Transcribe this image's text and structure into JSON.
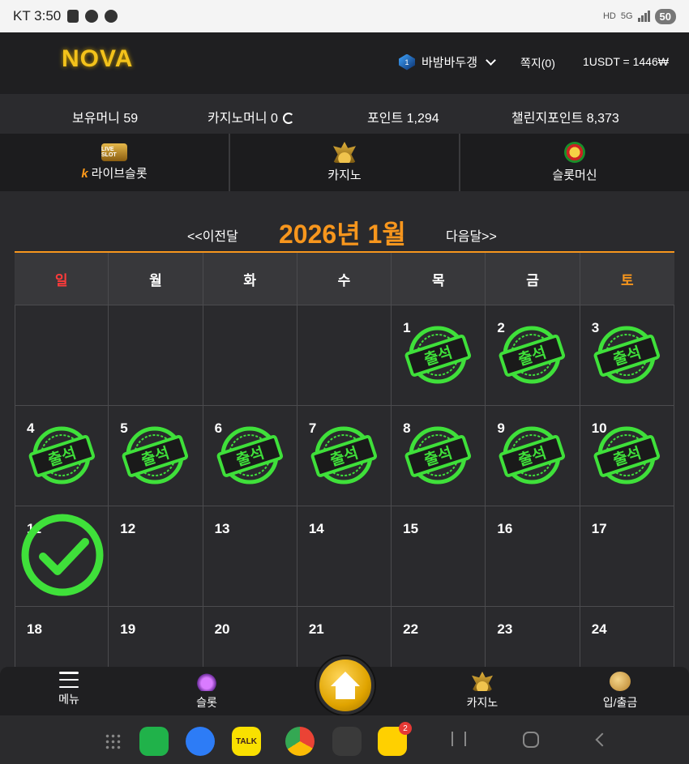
{
  "status_bar": {
    "carrier_time": "KT 3:50",
    "network": "5G",
    "hd": "HD",
    "battery": "50"
  },
  "header": {
    "logo": "NOVA",
    "user": {
      "rank": "1",
      "name": "바밤바두갱"
    },
    "messages_label": "쪽지(0)",
    "exchange_rate": "1USDT = 1446₩"
  },
  "balance": {
    "holding_money": "보유머니 59",
    "casino_money": "카지노머니 0",
    "points": "포인트 1,294",
    "challenge_points": "챌린지포인트 8,373"
  },
  "game_tabs": [
    {
      "label": "라이브슬롯",
      "icon": "live-slot-icon",
      "icon_text": "LIVE SLOT"
    },
    {
      "label": "카지노",
      "icon": "casino-crown-icon"
    },
    {
      "label": "슬롯머신",
      "icon": "slot-machine-icon"
    }
  ],
  "calendar": {
    "prev": "<<이전달",
    "title": "2026년 1월",
    "next": "다음달>>",
    "weekdays": [
      "일",
      "월",
      "화",
      "수",
      "목",
      "금",
      "토"
    ],
    "stamp_text": "출석",
    "weeks": [
      [
        {
          "day": "",
          "attended": false
        },
        {
          "day": "",
          "attended": false
        },
        {
          "day": "",
          "attended": false
        },
        {
          "day": "",
          "attended": false
        },
        {
          "day": "1",
          "attended": true
        },
        {
          "day": "2",
          "attended": true
        },
        {
          "day": "3",
          "attended": true
        }
      ],
      [
        {
          "day": "4",
          "attended": true
        },
        {
          "day": "5",
          "attended": true
        },
        {
          "day": "6",
          "attended": true
        },
        {
          "day": "7",
          "attended": true
        },
        {
          "day": "8",
          "attended": true
        },
        {
          "day": "9",
          "attended": true
        },
        {
          "day": "10",
          "attended": true
        }
      ],
      [
        {
          "day": "11",
          "attended": false,
          "today": true
        },
        {
          "day": "12",
          "attended": false
        },
        {
          "day": "13",
          "attended": false
        },
        {
          "day": "14",
          "attended": false
        },
        {
          "day": "15",
          "attended": false
        },
        {
          "day": "16",
          "attended": false
        },
        {
          "day": "17",
          "attended": false
        }
      ],
      [
        {
          "day": "18",
          "attended": false
        },
        {
          "day": "19",
          "attended": false
        },
        {
          "day": "20",
          "attended": false
        },
        {
          "day": "21",
          "attended": false
        },
        {
          "day": "22",
          "attended": false
        },
        {
          "day": "23",
          "attended": false
        },
        {
          "day": "24",
          "attended": false
        }
      ]
    ]
  },
  "bottom_nav": [
    {
      "label": "메뉴",
      "icon": "menu-icon"
    },
    {
      "label": "슬롯",
      "icon": "slot-icon"
    },
    {
      "label": "",
      "icon": "home-icon"
    },
    {
      "label": "카지노",
      "icon": "casino-icon"
    },
    {
      "label": "입/출금",
      "icon": "coins-icon"
    }
  ],
  "dock": {
    "bandcamp_badge": "2",
    "kakao_label": "TALK"
  },
  "colors": {
    "accent": "#f7961d",
    "stamp_green": "#3fe03a",
    "sunday": "#ff3b3b",
    "background": "#2a2a2d"
  }
}
